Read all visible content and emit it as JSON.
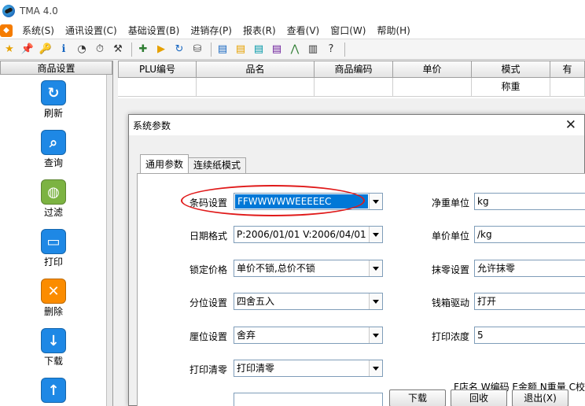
{
  "window": {
    "title": "TMA 4.0"
  },
  "menu": [
    "系统(S)",
    "通讯设置(C)",
    "基础设置(B)",
    "进销存(P)",
    "报表(R)",
    "查看(V)",
    "窗口(W)",
    "帮助(H)"
  ],
  "toolbar": [
    {
      "icon": "star-icon",
      "glyph": "★",
      "color": "#e6a100"
    },
    {
      "icon": "pin-icon",
      "glyph": "📌",
      "color": "#c62828"
    },
    {
      "icon": "key-icon",
      "glyph": "🔑",
      "color": "#b08000"
    },
    {
      "icon": "info-icon",
      "glyph": "ℹ",
      "color": "#1565c0"
    },
    {
      "icon": "clock-icon",
      "glyph": "◔",
      "color": "#333333"
    },
    {
      "icon": "timer-icon",
      "glyph": "⏱",
      "color": "#333333"
    },
    {
      "icon": "tools-icon",
      "glyph": "⚒",
      "color": "#333333"
    },
    {
      "icon": "add-icon",
      "glyph": "✚",
      "color": "#2e7d32"
    },
    {
      "icon": "play-icon",
      "glyph": "▶",
      "color": "#e6a100"
    },
    {
      "icon": "refresh-icon",
      "glyph": "↻",
      "color": "#1565c0"
    },
    {
      "icon": "database-icon",
      "glyph": "⛁",
      "color": "#555555"
    },
    {
      "icon": "doc-blue-icon",
      "glyph": "▤",
      "color": "#1565c0"
    },
    {
      "icon": "doc-yellow-icon",
      "glyph": "▤",
      "color": "#e6a100"
    },
    {
      "icon": "doc-cyan-icon",
      "glyph": "▤",
      "color": "#0097a7"
    },
    {
      "icon": "doc-purple-icon",
      "glyph": "▤",
      "color": "#6a1b9a"
    },
    {
      "icon": "chart-icon",
      "glyph": "⋀",
      "color": "#2e7d32"
    },
    {
      "icon": "barcode-icon",
      "glyph": "▥",
      "color": "#333333"
    },
    {
      "icon": "help-icon",
      "glyph": "?",
      "color": "#333333"
    }
  ],
  "sidebar": {
    "header": "商品设置",
    "items": [
      {
        "label": "刷新",
        "icon": "refresh-icon",
        "glyph": "↻",
        "color": "#1e88e5"
      },
      {
        "label": "查询",
        "icon": "search-icon",
        "glyph": "⌕",
        "color": "#1e88e5"
      },
      {
        "label": "过滤",
        "icon": "globe-icon",
        "glyph": "◍",
        "color": "#7cb342"
      },
      {
        "label": "打印",
        "icon": "video-icon",
        "glyph": "▭",
        "color": "#1e88e5"
      },
      {
        "label": "删除",
        "icon": "delete-icon",
        "glyph": "✕",
        "color": "#fb8c00"
      },
      {
        "label": "下载",
        "icon": "download-icon",
        "glyph": "↓",
        "color": "#1e88e5"
      },
      {
        "label": "",
        "icon": "upload-icon",
        "glyph": "↑",
        "color": "#1e88e5"
      }
    ]
  },
  "grid": {
    "columns": [
      "PLU编号",
      "品名",
      "商品编码",
      "单价",
      "模式",
      "有"
    ],
    "rows": [
      [
        "",
        "",
        "",
        "",
        "称重",
        ""
      ]
    ]
  },
  "dialog": {
    "title": "系统参数",
    "tabs": [
      "通用参数",
      "连续纸模式"
    ],
    "left_fields": [
      {
        "label": "条码设置",
        "value": "FFWWWWWEEEEEC",
        "selected": true
      },
      {
        "label": "日期格式",
        "value": "P:2006/01/01 V:2006/04/01",
        "selected": false
      },
      {
        "label": "锁定价格",
        "value": "单价不锁,总价不锁",
        "selected": false
      },
      {
        "label": "分位设置",
        "value": "四舍五入",
        "selected": false
      },
      {
        "label": "厘位设置",
        "value": "舍弃",
        "selected": false
      },
      {
        "label": "打印清零",
        "value": "打印清零",
        "selected": false
      }
    ],
    "right_fields": [
      {
        "label": "净重单位",
        "value": "kg"
      },
      {
        "label": "单价单位",
        "value": "/kg"
      },
      {
        "label": "抹零设置",
        "value": "允许抹零"
      },
      {
        "label": "钱箱驱动",
        "value": "打开"
      },
      {
        "label": "打印浓度",
        "value": "5"
      }
    ],
    "note": "F店名 W编码 E金额 N重量 C校",
    "buttons": {
      "download": "下载",
      "back": "回收",
      "exit": "退出(X)"
    },
    "highlight_color": "#e01a1a"
  }
}
